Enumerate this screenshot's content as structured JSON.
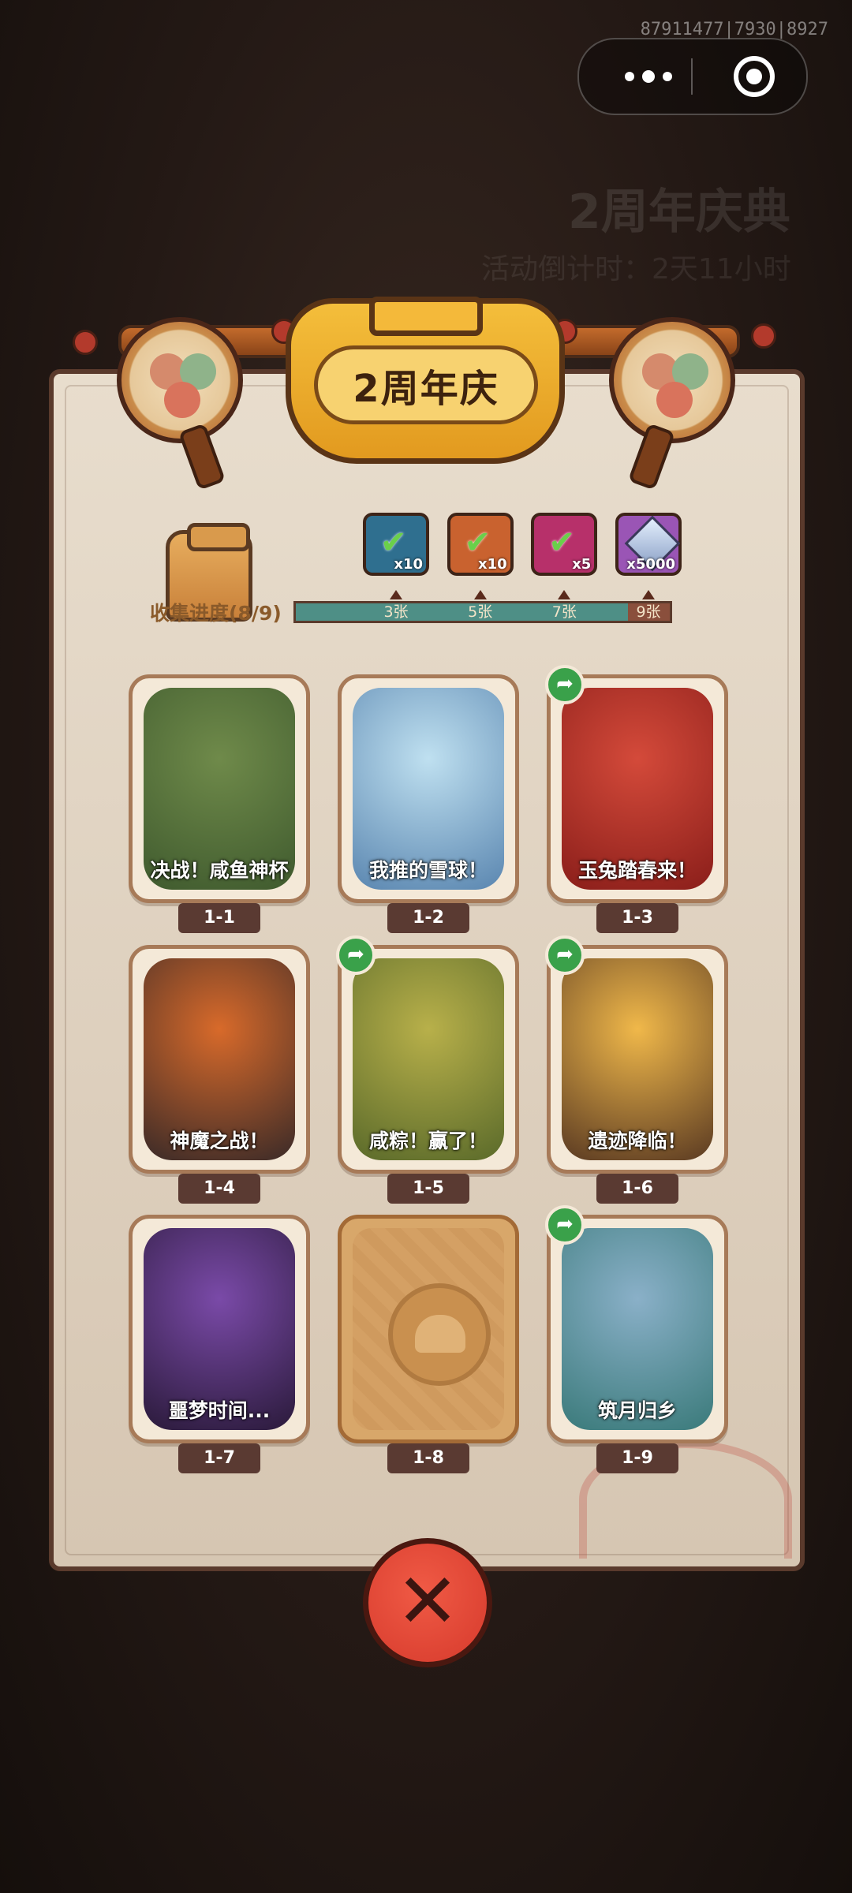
{
  "system": {
    "id_text": "87911477|7930|8927"
  },
  "background": {
    "title": "2周年庆典",
    "countdown": "活动倒计时：2天11小时"
  },
  "banner": {
    "title": "2周年庆"
  },
  "progress": {
    "label": "收集进度(8/9)",
    "collected": 8,
    "total": 9,
    "milestones": [
      {
        "label": "3张",
        "count": 3,
        "reward_icon": "treasure-chest-icon",
        "qty": "x10",
        "claimed": true,
        "color": "#2f6f8f"
      },
      {
        "label": "5张",
        "count": 5,
        "reward_icon": "scroll-ticket-icon",
        "qty": "x10",
        "claimed": true,
        "color": "#c9622f"
      },
      {
        "label": "7张",
        "count": 7,
        "reward_icon": "magic-orb-icon",
        "qty": "x5",
        "claimed": true,
        "color": "#b7306a"
      },
      {
        "label": "9张",
        "count": 9,
        "reward_icon": "diamond-gem-icon",
        "qty": "x5000",
        "claimed": false,
        "color": "#9a55b5"
      }
    ]
  },
  "cards": [
    {
      "tag": "1-1",
      "caption": "决战！咸鱼神杯",
      "unlocked": true,
      "share": false,
      "art_colors": [
        "#6f8a4a",
        "#3f5a2e"
      ]
    },
    {
      "tag": "1-2",
      "caption": "我推的雪球！",
      "unlocked": true,
      "share": false,
      "art_colors": [
        "#bfe0f0",
        "#5a86b0"
      ]
    },
    {
      "tag": "1-3",
      "caption": "玉兔踏春来！",
      "unlocked": true,
      "share": true,
      "art_colors": [
        "#d44a3a",
        "#8a1e1a"
      ]
    },
    {
      "tag": "1-4",
      "caption": "神魔之战！",
      "unlocked": true,
      "share": false,
      "art_colors": [
        "#d86a2a",
        "#3a2a28"
      ]
    },
    {
      "tag": "1-5",
      "caption": "咸粽！赢了！",
      "unlocked": true,
      "share": true,
      "art_colors": [
        "#b8b04a",
        "#5a6a2a"
      ]
    },
    {
      "tag": "1-6",
      "caption": "遗迹降临！",
      "unlocked": true,
      "share": true,
      "art_colors": [
        "#f0b84a",
        "#5a3a22"
      ]
    },
    {
      "tag": "1-7",
      "caption": "噩梦时间...",
      "unlocked": true,
      "share": false,
      "art_colors": [
        "#7a4aa8",
        "#2a1a3a"
      ]
    },
    {
      "tag": "1-8",
      "caption": "",
      "unlocked": false,
      "share": false,
      "art_colors": [
        "#d4a064",
        "#b07a40"
      ]
    },
    {
      "tag": "1-9",
      "caption": "筑月归乡",
      "unlocked": true,
      "share": true,
      "art_colors": [
        "#8ab0c8",
        "#3a7a7a"
      ]
    }
  ],
  "close_icon": "close-x-icon"
}
